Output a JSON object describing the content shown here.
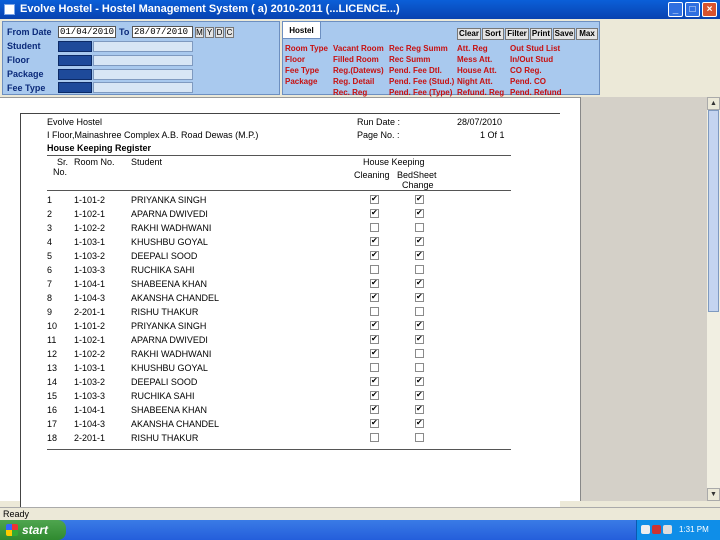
{
  "window": {
    "title": "Evolve Hostel - Hostel Management System ( a) 2010-2011 (...LICENCE...)"
  },
  "filter": {
    "from_label": "From Date",
    "from_value": "01/04/2010",
    "to_label": "To",
    "to_value": "28/07/2010",
    "period_buttons": [
      "M",
      "Y",
      "D",
      "C"
    ],
    "fields": [
      "Student",
      "Floor",
      "Package",
      "Fee Type"
    ]
  },
  "menu": {
    "tab": "Hostel",
    "toolbar": [
      "Clear",
      "Sort",
      "Filter",
      "Print",
      "Save",
      "Max"
    ],
    "links": [
      [
        "Room Type",
        "Floor",
        "Fee Type",
        "Package"
      ],
      [
        "Vacant Room",
        "Filled Room",
        "Reg.(Datews)",
        "Reg. Detail",
        "Rec. Reg"
      ],
      [
        "Rec Reg Summ",
        "Rec Summ",
        "Pend. Fee Dtl.",
        "Pend. Fee (Stud.)",
        "Pend. Fee (Type)"
      ],
      [
        "Att. Reg",
        "Mess Att.",
        "House Att.",
        "Night Att.",
        "Refund. Reg"
      ],
      [
        "Out Stud List",
        "In/Out Stud",
        "CO Reg.",
        "Pend. CO",
        "Pend. Refund"
      ]
    ]
  },
  "report": {
    "org_name": "Evolve Hostel",
    "address": "I Floor,Mainashree Complex A.B. Road Dewas (M.P.)",
    "title": "House Keeping Register",
    "run_date_label": "Run Date :",
    "run_date": "28/07/2010",
    "page_label": "Page No. :",
    "page_value": "1 Of 1",
    "columns": {
      "sr": "Sr.",
      "sr2": "No.",
      "room": "Room No.",
      "student": "Student",
      "group": "House Keeping",
      "cleaning": "Cleaning",
      "bedsheet1": "BedSheet",
      "bedsheet2": "Change"
    },
    "rows": [
      {
        "sr": "1",
        "room": "1-101-2",
        "student": "PRIYANKA SINGH",
        "cleaning": true,
        "bedsheet": true
      },
      {
        "sr": "2",
        "room": "1-102-1",
        "student": "APARNA  DWIVEDI",
        "cleaning": true,
        "bedsheet": true
      },
      {
        "sr": "3",
        "room": "1-102-2",
        "student": "RAKHI WADHWANI",
        "cleaning": false,
        "bedsheet": false
      },
      {
        "sr": "4",
        "room": "1-103-1",
        "student": "KHUSHBU  GOYAL",
        "cleaning": true,
        "bedsheet": true
      },
      {
        "sr": "5",
        "room": "1-103-2",
        "student": "DEEPALI  SOOD",
        "cleaning": true,
        "bedsheet": true
      },
      {
        "sr": "6",
        "room": "1-103-3",
        "student": "RUCHIKA  SAHI",
        "cleaning": false,
        "bedsheet": false
      },
      {
        "sr": "7",
        "room": "1-104-1",
        "student": "SHABEENA KHAN",
        "cleaning": true,
        "bedsheet": true
      },
      {
        "sr": "8",
        "room": "1-104-3",
        "student": "AKANSHA CHANDEL",
        "cleaning": true,
        "bedsheet": true
      },
      {
        "sr": "9",
        "room": "2-201-1",
        "student": "RISHU  THAKUR",
        "cleaning": false,
        "bedsheet": false
      },
      {
        "sr": "10",
        "room": "1-101-2",
        "student": "PRIYANKA SINGH",
        "cleaning": true,
        "bedsheet": true
      },
      {
        "sr": "11",
        "room": "1-102-1",
        "student": "APARNA  DWIVEDI",
        "cleaning": true,
        "bedsheet": true
      },
      {
        "sr": "12",
        "room": "1-102-2",
        "student": "RAKHI WADHWANI",
        "cleaning": true,
        "bedsheet": false
      },
      {
        "sr": "13",
        "room": "1-103-1",
        "student": "KHUSHBU  GOYAL",
        "cleaning": false,
        "bedsheet": false
      },
      {
        "sr": "14",
        "room": "1-103-2",
        "student": "DEEPALI  SOOD",
        "cleaning": true,
        "bedsheet": true
      },
      {
        "sr": "15",
        "room": "1-103-3",
        "student": "RUCHIKA  SAHI",
        "cleaning": true,
        "bedsheet": true
      },
      {
        "sr": "16",
        "room": "1-104-1",
        "student": "SHABEENA KHAN",
        "cleaning": true,
        "bedsheet": true
      },
      {
        "sr": "17",
        "room": "1-104-3",
        "student": "AKANSHA CHANDEL",
        "cleaning": true,
        "bedsheet": true
      },
      {
        "sr": "18",
        "room": "2-201-1",
        "student": "RISHU  THAKUR",
        "cleaning": false,
        "bedsheet": false
      }
    ]
  },
  "status": {
    "text": "Ready"
  },
  "taskbar": {
    "start_label": "start",
    "clock": "1:31 PM"
  },
  "colors": {
    "titlebar": "#0a5fd8",
    "panel": "#a9c9ee",
    "link": "#c81010",
    "field_dark": "#1e4a9a"
  },
  "icons": [
    "app-icon",
    "minimize-icon",
    "maximize-icon",
    "close-icon",
    "windows-flag-icon",
    "tray-icon"
  ]
}
